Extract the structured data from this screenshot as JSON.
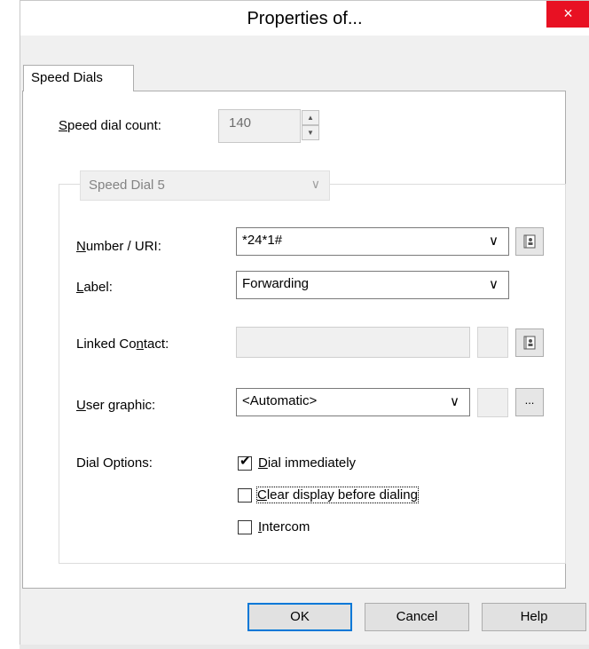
{
  "window": {
    "title": "Properties of...",
    "close_glyph": "×"
  },
  "tabs": [
    {
      "label": "Speed Dials",
      "selected": true
    }
  ],
  "speed_dial_count": {
    "label": "Speed dial count:",
    "value": "140"
  },
  "group": {
    "selector_value": "Speed Dial 5"
  },
  "fields": {
    "number_uri": {
      "label": "Number / URI:",
      "value": "*24*1#"
    },
    "label": {
      "label": "Label:",
      "value": "Forwarding"
    },
    "linked_contact": {
      "label": "Linked Contact:",
      "value": ""
    },
    "user_graphic": {
      "label": "User graphic:",
      "value": "<Automatic>",
      "browse_label": "..."
    }
  },
  "dial_options": {
    "label": "Dial Options:",
    "items": [
      {
        "label": "Dial immediately",
        "checked": true
      },
      {
        "label": "Clear display before dialing",
        "checked": false
      },
      {
        "label": "Intercom",
        "checked": false
      }
    ]
  },
  "buttons": {
    "ok": "OK",
    "cancel": "Cancel",
    "help": "Help"
  },
  "icons": {
    "close": "close-icon",
    "spin_up": "arrow-up-icon",
    "spin_down": "arrow-down-icon",
    "dropdown": "chevron-down-icon",
    "address_book": "address-book-icon",
    "checkmark": "checkmark-icon"
  },
  "colors": {
    "close_button": "#e81123",
    "default_button_border": "#0078d7",
    "dialog_background": "#f0f0f0"
  }
}
